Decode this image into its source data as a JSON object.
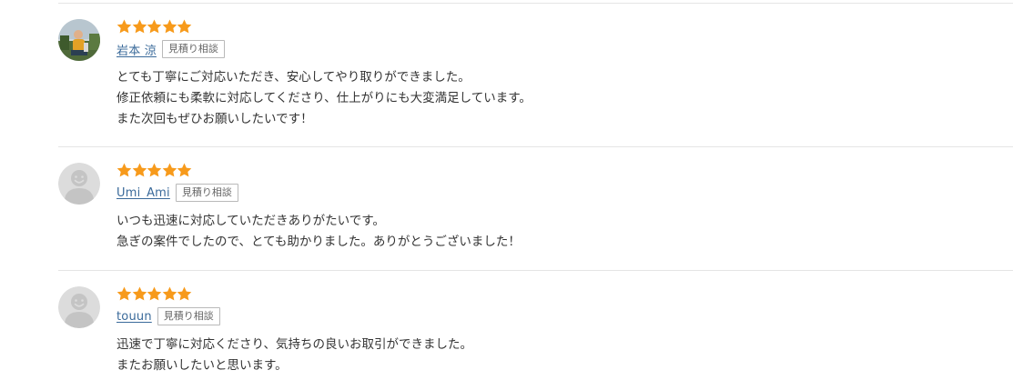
{
  "colors": {
    "star": "#f79a1b",
    "username": "#3a6a9a",
    "divider": "#e5e5e5",
    "badge_border": "#b9b9b9"
  },
  "reviews": [
    {
      "rating": 5,
      "avatar": "user-photo",
      "username": "岩本 涼",
      "badge": "見積り相談",
      "lines": [
        "とても丁寧にご対応いただき、安心してやり取りができました。",
        "修正依頼にも柔軟に対応してくださり、仕上がりにも大変満足しています。",
        "また次回もぜひお願いしたいです！"
      ]
    },
    {
      "rating": 5,
      "avatar": "default-user-icon",
      "username": "Umi_Ami",
      "badge": "見積り相談",
      "lines": [
        "いつも迅速に対応していただきありがたいです。",
        "急ぎの案件でしたので、とても助かりました。ありがとうございました！"
      ]
    },
    {
      "rating": 5,
      "avatar": "default-user-icon",
      "username": "touun",
      "badge": "見積り相談",
      "lines": [
        "迅速で丁寧に対応くださり、気持ちの良いお取引ができました。",
        "またお願いしたいと思います。"
      ]
    }
  ]
}
